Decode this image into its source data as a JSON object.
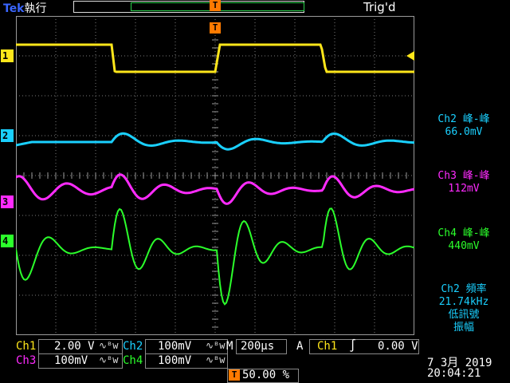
{
  "header": {
    "brand_text": "Tek",
    "run_state": "執行",
    "trigger_status": "Trig'd",
    "trigger_position_marker": "T"
  },
  "markers": {
    "ch1": "1",
    "ch2": "2",
    "ch3": "3",
    "ch4": "4",
    "trigger": "T"
  },
  "measurements": {
    "ch2_title": "Ch2 峰-峰",
    "ch2_value": "66.0mV",
    "ch3_title": "Ch3 峰-峰",
    "ch3_value": "112mV",
    "ch4_title": "Ch4 峰-峰",
    "ch4_value": "440mV",
    "freq_line1": "Ch2 頻率",
    "freq_line2": "21.74kHz",
    "freq_line3": "低訊號",
    "freq_line4": "振幅"
  },
  "bottom": {
    "ch1_label": "Ch1",
    "ch1_scale": "2.00 V",
    "ch2_label": "Ch2",
    "ch2_scale": "100mV",
    "timebase_label": "M",
    "timebase_value": "200µs",
    "coupling_label": "A",
    "trigger_source": "Ch1",
    "trigger_slope": "∫",
    "trigger_level": "0.00 V",
    "ch3_label": "Ch3",
    "ch3_scale": "100mV",
    "ch4_label": "Ch4",
    "ch4_scale": "100mV",
    "bw_icon": "∿ᴮw",
    "position_value": "50.00 %",
    "date": "7 3月  2019",
    "time": "20:04:21"
  },
  "colors": {
    "ch1": "#ffe61a",
    "ch2": "#1ad0ff",
    "ch3": "#ff2bff",
    "ch4": "#2bff2b",
    "trigger": "#ff7a00",
    "grid": "#8a8a8a"
  }
}
